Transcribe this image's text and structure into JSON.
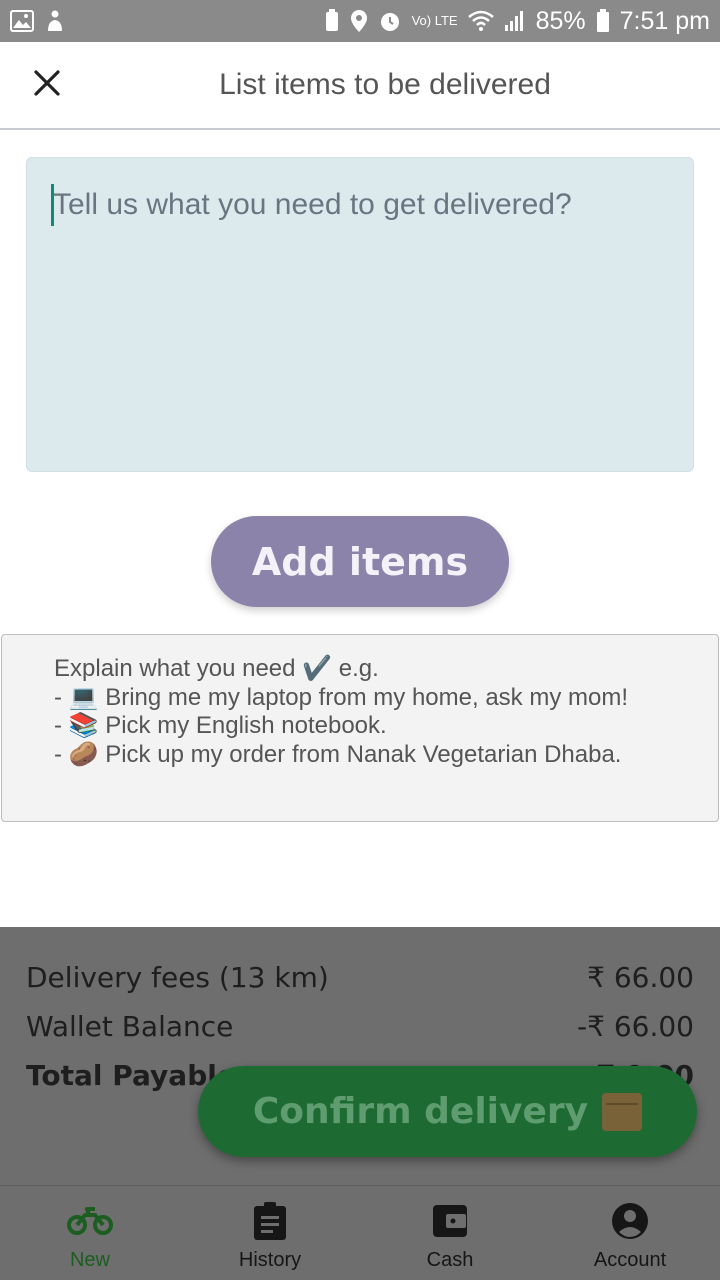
{
  "status_bar": {
    "battery": "85%",
    "time": "7:51 pm",
    "network": "Vo) LTE"
  },
  "header": {
    "title": "List items to be delivered",
    "close_icon": "close-icon"
  },
  "items_input": {
    "value": "",
    "placeholder": "Tell us what you need to get delivered?"
  },
  "add_items_button": {
    "label": "Add items",
    "color": "#8c83ab"
  },
  "hint": {
    "lines": [
      "Explain what you need ✔️ e.g.",
      "- 💻 Bring me my laptop from my home, ask my mom!",
      "- 📚 Pick my English notebook.",
      "- 🥔 Pick up my order from Nanak Vegetarian Dhaba."
    ]
  },
  "summary": {
    "delivery_fees_label": "Delivery fees (13 km)",
    "delivery_fees_value": "₹ 66.00",
    "wallet_label": "Wallet Balance",
    "wallet_value": "-₹ 66.00",
    "total_label": "Total Payable",
    "total_value": "₹ 0.00"
  },
  "confirm_button": {
    "label": "Confirm delivery",
    "color": "#1d6b33"
  },
  "bottom_nav": {
    "items": [
      {
        "label": "New",
        "icon": "motorbike-icon",
        "active": true
      },
      {
        "label": "History",
        "icon": "clipboard-icon",
        "active": false
      },
      {
        "label": "Cash",
        "icon": "wallet-icon",
        "active": false
      },
      {
        "label": "Account",
        "icon": "account-circle-icon",
        "active": false
      }
    ]
  }
}
